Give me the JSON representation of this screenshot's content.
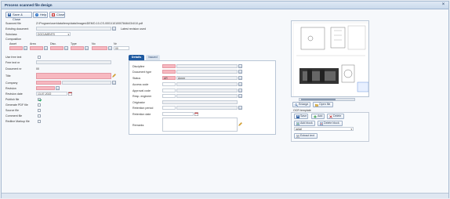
{
  "window": {
    "title": "Process scanned file design"
  },
  "toolbar": {
    "save_close": "Save & Close",
    "help": "Help",
    "close": "Close"
  },
  "form": {
    "scanned_file_label": "Scanned file",
    "scanned_file_value": "Z:\\Program\\user\\data\\temp\\data\\Images\\DEMO-10-CS-0001\\10100078464\\3\\4\\10.pdf",
    "existing_document_label": "Existing document",
    "latest_revision_label": "Latest revision used",
    "subclass_label": "Subclass",
    "subclass_value": "DOCUMENTS",
    "composition_label": "Composition",
    "composition_columns": [
      "Asset",
      "Area",
      "Disc.",
      "Type",
      "No",
      "Nr"
    ],
    "composition_values": [
      "",
      "",
      "",
      "",
      "",
      "00"
    ],
    "use_free_text_label": "Use free text",
    "free_text_nr_label": "Free text nr",
    "document_nr_label": "Document nr",
    "document_nr_value": "00",
    "title_label": "Title",
    "company_label": "Company",
    "revision_label": "Revision",
    "revision_date_label": "Revision date",
    "revision_date_value": "13-07-2022",
    "publish_file_label": "Publish file",
    "generate_pdf_label": "Generate PDF file",
    "source_file_label": "Source file",
    "comment_file_label": "Comment file",
    "redline_markup_label": "Redline Markup file"
  },
  "tabs": {
    "details": "Details",
    "issued": "Issued"
  },
  "details": {
    "discipline_label": "Discipline",
    "document_type_label": "Document type",
    "status_label": "Status",
    "status_code": "AR",
    "status_value": "Armer",
    "access_code_label": "Access code",
    "approval_code_label": "Approval code",
    "resp_engineer_label": "Resp. engineer",
    "originator_label": "Originator",
    "retention_period_label": "Retention period",
    "retention_date_label": "Retention date",
    "remarks_label": "Remarks"
  },
  "preview": {
    "enlarge": "Enlarge",
    "open_file": "Open file",
    "ocr_template_label": "OCR template",
    "save": "Save",
    "add": "Add",
    "delete": "Delete",
    "add_block": "Add block",
    "delete_block": "Delete block",
    "template_value": "azkal",
    "extract_text": "Extract text"
  },
  "colors": {
    "required": "#f7b8c0",
    "active_tab": "#1f5aa0",
    "title_bg": "#c9d9ec"
  }
}
